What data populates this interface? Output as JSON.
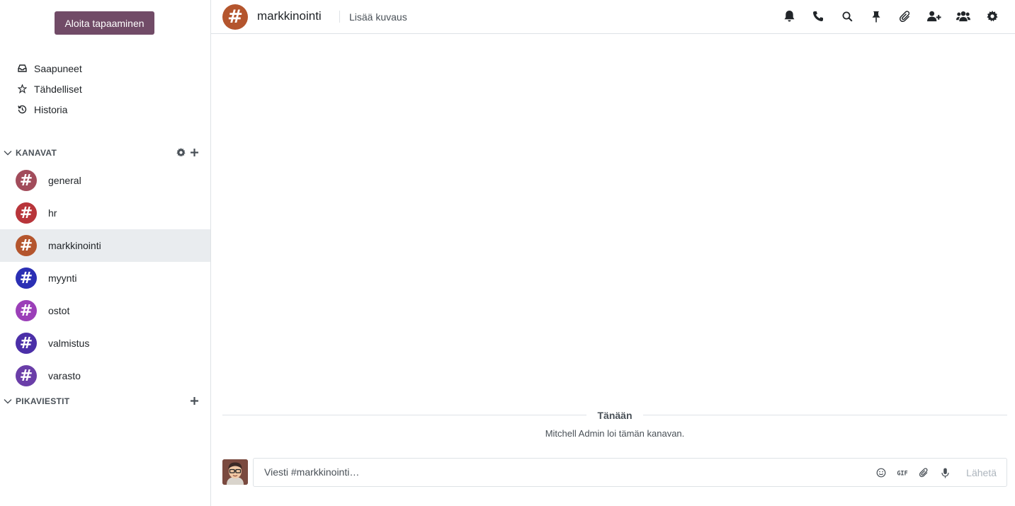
{
  "sidebar": {
    "meeting_button": "Aloita tapaaminen",
    "mailboxes": [
      {
        "label": "Saapuneet",
        "icon": "inbox-icon"
      },
      {
        "label": "Tähdelliset",
        "icon": "star-icon"
      },
      {
        "label": "Historia",
        "icon": "history-icon"
      }
    ],
    "channels_header": "KANAVAT",
    "channels": [
      {
        "name": "general",
        "color": "#a24c5b",
        "active": false
      },
      {
        "name": "hr",
        "color": "#b8353a",
        "active": false
      },
      {
        "name": "markkinointi",
        "color": "#b4552d",
        "active": true
      },
      {
        "name": "myynti",
        "color": "#2b2fb4",
        "active": false
      },
      {
        "name": "ostot",
        "color": "#9b3fb8",
        "active": false
      },
      {
        "name": "valmistus",
        "color": "#4b2fa8",
        "active": false
      },
      {
        "name": "varasto",
        "color": "#6a3ea8",
        "active": false
      }
    ],
    "chats_header": "PIKAVIESTIT"
  },
  "header": {
    "avatar_glyph": "#",
    "title": "markkinointi",
    "description_placeholder": "Lisää kuvaus",
    "tools": [
      "bell-icon",
      "phone-icon",
      "search-icon",
      "pin-icon",
      "paperclip-icon",
      "add-user-icon",
      "members-icon",
      "gear-icon"
    ]
  },
  "thread": {
    "date_separator": "Tänään",
    "notice": "Mitchell Admin loi tämän kanavan."
  },
  "composer": {
    "placeholder": "Viesti #markkinointi…",
    "gif_label": "GIF",
    "send_label": "Lähetä"
  },
  "colors": {
    "primary": "#714b67",
    "active_bg": "#e9ecef",
    "border": "#dee2e6"
  }
}
